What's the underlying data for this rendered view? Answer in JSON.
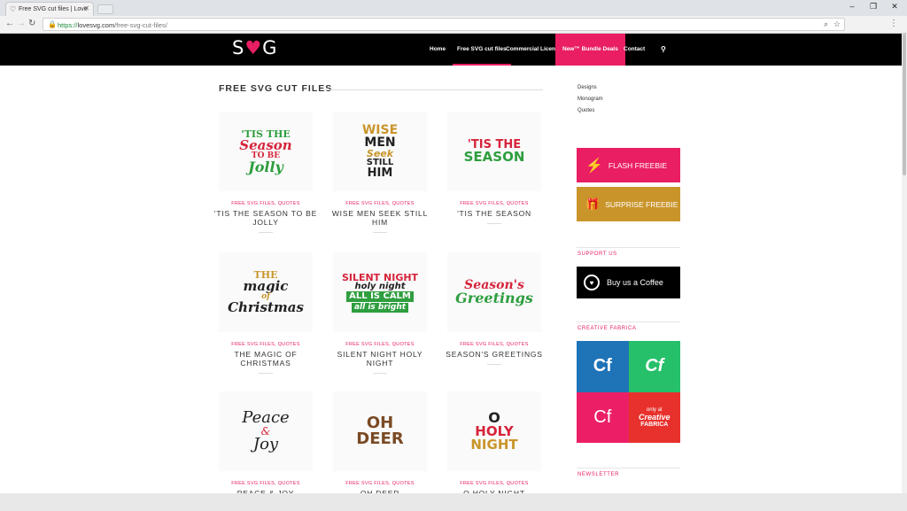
{
  "browser": {
    "tab_title": "Free SVG cut files | Love",
    "tab_favicon": "heart-icon",
    "url_protocol": "https://",
    "url_domain": "lovesvg.com",
    "url_path": "/free-svg-cut-files/"
  },
  "header": {
    "logo_left": "S",
    "logo_heart": "♥",
    "logo_right": "G",
    "nav": [
      "Home",
      "Free SVG cut files",
      "Commercial License",
      "New™ Bundle Deals",
      "Contact"
    ],
    "accent": "#e91e63"
  },
  "main": {
    "title": "FREE SVG CUT FILES",
    "products": [
      {
        "cats": "FREE SVG FILES, QUOTES",
        "name": "'TIS THE SEASON TO BE JOLLY",
        "art": [
          "'TIS THE",
          "Season",
          "TO BE",
          "Jolly"
        ]
      },
      {
        "cats": "FREE SVG FILES, QUOTES",
        "name": "WISE MEN SEEK STILL HIM",
        "art": [
          "WISE",
          "MEN",
          "Seek",
          "STILL",
          "HIM"
        ]
      },
      {
        "cats": "FREE SVG FILES, QUOTES",
        "name": "'TIS THE SEASON",
        "art": [
          "'TIS THE",
          "SEASON"
        ]
      },
      {
        "cats": "FREE SVG FILES, QUOTES",
        "name": "THE MAGIC OF CHRISTMAS",
        "art": [
          "THE",
          "magic",
          "of",
          "Christmas"
        ]
      },
      {
        "cats": "FREE SVG FILES, QUOTES",
        "name": "SILENT NIGHT HOLY NIGHT",
        "art": [
          "SILENT NIGHT",
          "holy night",
          "ALL IS CALM",
          "all is bright"
        ]
      },
      {
        "cats": "FREE SVG FILES, QUOTES",
        "name": "SEASON'S GREETINGS",
        "art": [
          "Season's",
          "Greetings"
        ]
      },
      {
        "cats": "FREE SVG FILES, QUOTES",
        "name": "PEACE & JOY",
        "art": [
          "Peace",
          "&",
          "Joy"
        ]
      },
      {
        "cats": "FREE SVG FILES, QUOTES",
        "name": "OH DEER",
        "art": [
          "OH",
          "DEER"
        ]
      },
      {
        "cats": "FREE SVG FILES, QUOTES",
        "name": "O HOLY NIGHT",
        "art": [
          "O",
          "HOLY",
          "NIGHT"
        ]
      }
    ]
  },
  "sidebar": {
    "links": [
      "Designs",
      "Monogram",
      "Quotes"
    ],
    "flash_label": "FLASH FREEBIE",
    "surprise_label": "SURPRISE FREEBIE",
    "support_heading": "SUPPORT US",
    "coffee_label": "Buy us a Coffee",
    "fabrica_heading": "CREATIVE FABRICA",
    "fabrica_tiles": [
      "Cf",
      "Cf",
      "Cf",
      "only at"
    ],
    "fabrica_brand": "Creative",
    "fabrica_brand2": "FABRICA",
    "newsletter_heading": "NEWSLETTER"
  }
}
